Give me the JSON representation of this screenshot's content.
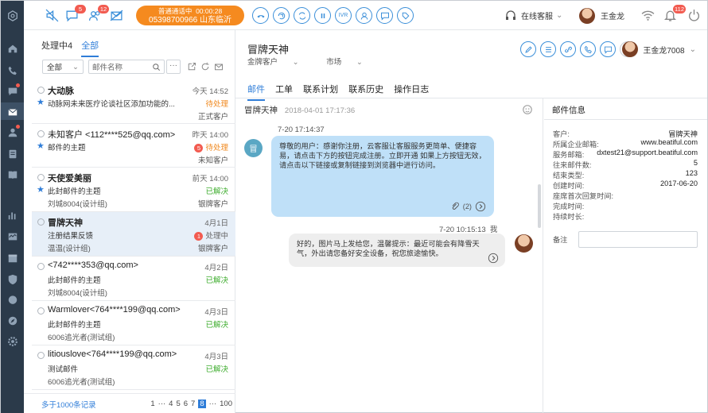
{
  "topbar": {
    "badges": {
      "chat": "5",
      "users": "12",
      "alerts": "112"
    },
    "call": {
      "status": "普通通话中",
      "timer": "00:00:28",
      "number": "05398700966 山东临沂"
    },
    "call_buttons": [
      "hangup",
      "hold",
      "transfer",
      "pause"
    ],
    "ivr_label": "IVR",
    "online_status": "在线客服",
    "agent_name": "王金龙"
  },
  "list": {
    "tabs": [
      {
        "label": "处理中4"
      },
      {
        "label": "全部"
      }
    ],
    "filter": {
      "selected": "全部",
      "search_placeholder": "邮件名称",
      "more": "···"
    },
    "items": [
      {
        "name": "大动脉",
        "time": "今天 14:52",
        "subject": "动脉网未来医疗论谈社区添加功能的...",
        "status": "待处理",
        "status_num": "",
        "group": "",
        "category": "正式客户",
        "starred": true
      },
      {
        "name": "未知客户 <112****525@qq.com>",
        "time": "昨天 14:00",
        "subject": "邮件的主题",
        "status": "待处理",
        "status_num": "5",
        "group": "",
        "category": "未知客户",
        "starred": true
      },
      {
        "name": "天使爱美丽",
        "time": "前天 14:00",
        "subject": "此封邮件的主题",
        "status": "已解决",
        "status_num": "",
        "group": "刘城8004(设计组)",
        "category": "银牌客户",
        "starred": true
      },
      {
        "name": "冒牌天神",
        "time": "4月1日",
        "subject": "注册结果反馈",
        "status": "处理中",
        "status_num": "1",
        "group": "温温(设计组)",
        "category": "银牌客户",
        "starred": false
      },
      {
        "name": "<742****353@qq.com>",
        "time": "4月2日",
        "subject": "此封邮件的主题",
        "status": "已解决",
        "status_num": "",
        "group": "刘城8004(设计组)",
        "category": "",
        "starred": false
      },
      {
        "name": "Warmlover<764****199@qq.com>",
        "time": "4月3日",
        "subject": "此封邮件的主题",
        "status": "已解决",
        "status_num": "",
        "group": "6006追光者(测试组)",
        "category": "",
        "starred": false
      },
      {
        "name": "litiouslove<764****199@qq.com>",
        "time": "4月3日",
        "subject": "测试邮件",
        "status": "已解决",
        "status_num": "",
        "group": "6006追光者(测试组)",
        "category": "",
        "starred": false
      }
    ],
    "pager": {
      "records": "多于1000条记录",
      "pages": [
        "1",
        "···",
        "4",
        "5",
        "6",
        "7",
        "8",
        "···",
        "100"
      ],
      "current": "8"
    }
  },
  "detail": {
    "title": "冒牌天神",
    "meta": [
      "金牌客户",
      "市场"
    ],
    "user": "王金龙7008",
    "tabs": [
      "邮件",
      "工单",
      "联系计划",
      "联系历史",
      "操作日志"
    ],
    "conversation": {
      "subject": "冒牌天神",
      "date": "2018-04-01 17:17:36",
      "msg1": {
        "time": "7-20  17:14:37",
        "avatar": "冒",
        "text": "尊敬的用户：感谢你注册，云客服让客服服务更简单、便捷容易，请点击下方的按钮完成注册。立即开通 如果上方按钮无效，请点击以下链接或复制链接到浏览器中进行访问。",
        "attachments": "(2)"
      },
      "msg2": {
        "time": "7-20  10:15:13",
        "sender": "我",
        "text": "好的，图片马上发给您，温馨提示：最近可能会有降雪天气，外出请您备好安全设备，祝您旅途愉快。"
      }
    },
    "info": {
      "title": "邮件信息",
      "rows": [
        {
          "k": "客户:",
          "v": "冒牌天神"
        },
        {
          "k": "所属企业邮箱:",
          "v": "www.beatiful.com"
        },
        {
          "k": "服务邮箱:",
          "v": "dxtest21@support.beatiful.com"
        },
        {
          "k": "往来邮件数:",
          "v": "5"
        },
        {
          "k": "结束类型:",
          "v": "123"
        },
        {
          "k": "创建时间:",
          "v": "2017-06-20"
        },
        {
          "k": "座席首次回复时间:",
          "v": ""
        },
        {
          "k": "完成时间:",
          "v": ""
        },
        {
          "k": "持续时长:",
          "v": ""
        }
      ],
      "note_label": "备注"
    }
  }
}
